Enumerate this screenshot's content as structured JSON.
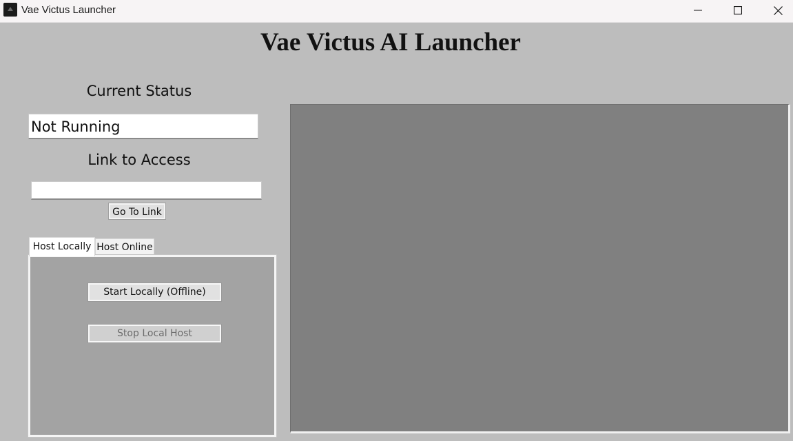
{
  "window": {
    "title": "Vae Victus Launcher",
    "controls": [
      "minimize-icon",
      "maximize-icon",
      "close-icon"
    ]
  },
  "heading": "Vae Victus AI Launcher",
  "status": {
    "label": "Current Status",
    "value": "Not Running"
  },
  "link": {
    "label": "Link to Access",
    "value": "",
    "button_label": "Go To Link"
  },
  "tabs": [
    {
      "label": "Host Locally",
      "active": true
    },
    {
      "label": "Host Online",
      "active": false
    }
  ],
  "local_panel": {
    "start_label": "Start Locally (Offline)",
    "stop_label": "Stop Local Host",
    "stop_enabled": false
  },
  "colors": {
    "background": "#bdbdbd",
    "display_area": "#808080",
    "tab_panel": "#a3a3a3",
    "titlebar": "#f7f4f5"
  }
}
